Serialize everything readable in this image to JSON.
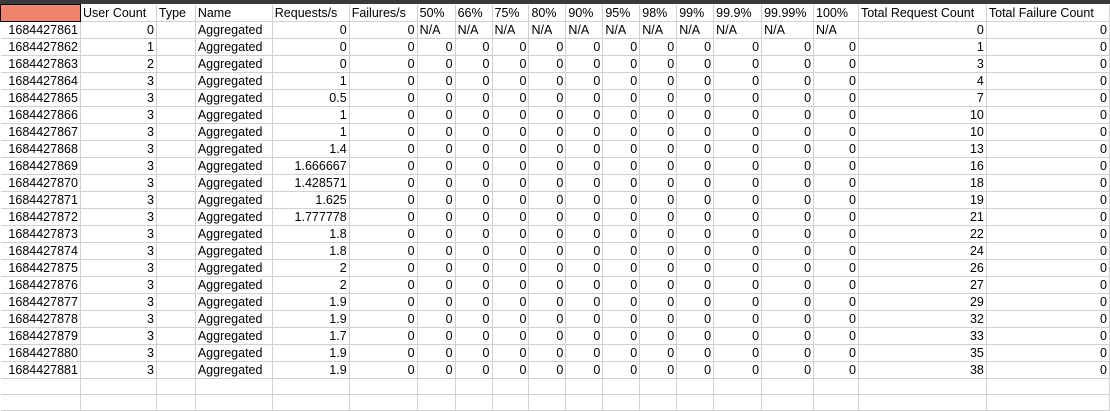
{
  "sheet": {
    "headers": [
      "",
      "User Count",
      "Type",
      "Name",
      "Requests/s",
      "Failures/s",
      "50%",
      "66%",
      "75%",
      "80%",
      "90%",
      "95%",
      "98%",
      "99%",
      "99.9%",
      "99.99%",
      "100%",
      "Total Request Count",
      "Total Failure Count"
    ],
    "rows": [
      [
        "1684427861",
        "0",
        "",
        "Aggregated",
        "0",
        "0",
        "N/A",
        "N/A",
        "N/A",
        "N/A",
        "N/A",
        "N/A",
        "N/A",
        "N/A",
        "N/A",
        "N/A",
        "N/A",
        "0",
        "0"
      ],
      [
        "1684427862",
        "1",
        "",
        "Aggregated",
        "0",
        "0",
        "0",
        "0",
        "0",
        "0",
        "0",
        "0",
        "0",
        "0",
        "0",
        "0",
        "0",
        "1",
        "0"
      ],
      [
        "1684427863",
        "2",
        "",
        "Aggregated",
        "0",
        "0",
        "0",
        "0",
        "0",
        "0",
        "0",
        "0",
        "0",
        "0",
        "0",
        "0",
        "0",
        "3",
        "0"
      ],
      [
        "1684427864",
        "3",
        "",
        "Aggregated",
        "1",
        "0",
        "0",
        "0",
        "0",
        "0",
        "0",
        "0",
        "0",
        "0",
        "0",
        "0",
        "0",
        "4",
        "0"
      ],
      [
        "1684427865",
        "3",
        "",
        "Aggregated",
        "0.5",
        "0",
        "0",
        "0",
        "0",
        "0",
        "0",
        "0",
        "0",
        "0",
        "0",
        "0",
        "0",
        "7",
        "0"
      ],
      [
        "1684427866",
        "3",
        "",
        "Aggregated",
        "1",
        "0",
        "0",
        "0",
        "0",
        "0",
        "0",
        "0",
        "0",
        "0",
        "0",
        "0",
        "0",
        "10",
        "0"
      ],
      [
        "1684427867",
        "3",
        "",
        "Aggregated",
        "1",
        "0",
        "0",
        "0",
        "0",
        "0",
        "0",
        "0",
        "0",
        "0",
        "0",
        "0",
        "0",
        "10",
        "0"
      ],
      [
        "1684427868",
        "3",
        "",
        "Aggregated",
        "1.4",
        "0",
        "0",
        "0",
        "0",
        "0",
        "0",
        "0",
        "0",
        "0",
        "0",
        "0",
        "0",
        "13",
        "0"
      ],
      [
        "1684427869",
        "3",
        "",
        "Aggregated",
        "1.666667",
        "0",
        "0",
        "0",
        "0",
        "0",
        "0",
        "0",
        "0",
        "0",
        "0",
        "0",
        "0",
        "16",
        "0"
      ],
      [
        "1684427870",
        "3",
        "",
        "Aggregated",
        "1.428571",
        "0",
        "0",
        "0",
        "0",
        "0",
        "0",
        "0",
        "0",
        "0",
        "0",
        "0",
        "0",
        "18",
        "0"
      ],
      [
        "1684427871",
        "3",
        "",
        "Aggregated",
        "1.625",
        "0",
        "0",
        "0",
        "0",
        "0",
        "0",
        "0",
        "0",
        "0",
        "0",
        "0",
        "0",
        "19",
        "0"
      ],
      [
        "1684427872",
        "3",
        "",
        "Aggregated",
        "1.777778",
        "0",
        "0",
        "0",
        "0",
        "0",
        "0",
        "0",
        "0",
        "0",
        "0",
        "0",
        "0",
        "21",
        "0"
      ],
      [
        "1684427873",
        "3",
        "",
        "Aggregated",
        "1.8",
        "0",
        "0",
        "0",
        "0",
        "0",
        "0",
        "0",
        "0",
        "0",
        "0",
        "0",
        "0",
        "22",
        "0"
      ],
      [
        "1684427874",
        "3",
        "",
        "Aggregated",
        "1.8",
        "0",
        "0",
        "0",
        "0",
        "0",
        "0",
        "0",
        "0",
        "0",
        "0",
        "0",
        "0",
        "24",
        "0"
      ],
      [
        "1684427875",
        "3",
        "",
        "Aggregated",
        "2",
        "0",
        "0",
        "0",
        "0",
        "0",
        "0",
        "0",
        "0",
        "0",
        "0",
        "0",
        "0",
        "26",
        "0"
      ],
      [
        "1684427876",
        "3",
        "",
        "Aggregated",
        "2",
        "0",
        "0",
        "0",
        "0",
        "0",
        "0",
        "0",
        "0",
        "0",
        "0",
        "0",
        "0",
        "27",
        "0"
      ],
      [
        "1684427877",
        "3",
        "",
        "Aggregated",
        "1.9",
        "0",
        "0",
        "0",
        "0",
        "0",
        "0",
        "0",
        "0",
        "0",
        "0",
        "0",
        "0",
        "29",
        "0"
      ],
      [
        "1684427878",
        "3",
        "",
        "Aggregated",
        "1.9",
        "0",
        "0",
        "0",
        "0",
        "0",
        "0",
        "0",
        "0",
        "0",
        "0",
        "0",
        "0",
        "32",
        "0"
      ],
      [
        "1684427879",
        "3",
        "",
        "Aggregated",
        "1.7",
        "0",
        "0",
        "0",
        "0",
        "0",
        "0",
        "0",
        "0",
        "0",
        "0",
        "0",
        "0",
        "33",
        "0"
      ],
      [
        "1684427880",
        "3",
        "",
        "Aggregated",
        "1.9",
        "0",
        "0",
        "0",
        "0",
        "0",
        "0",
        "0",
        "0",
        "0",
        "0",
        "0",
        "0",
        "35",
        "0"
      ],
      [
        "1684427881",
        "3",
        "",
        "Aggregated",
        "1.9",
        "0",
        "0",
        "0",
        "0",
        "0",
        "0",
        "0",
        "0",
        "0",
        "0",
        "0",
        "0",
        "38",
        "0"
      ]
    ],
    "selected_cell_color": "#f0836e"
  }
}
